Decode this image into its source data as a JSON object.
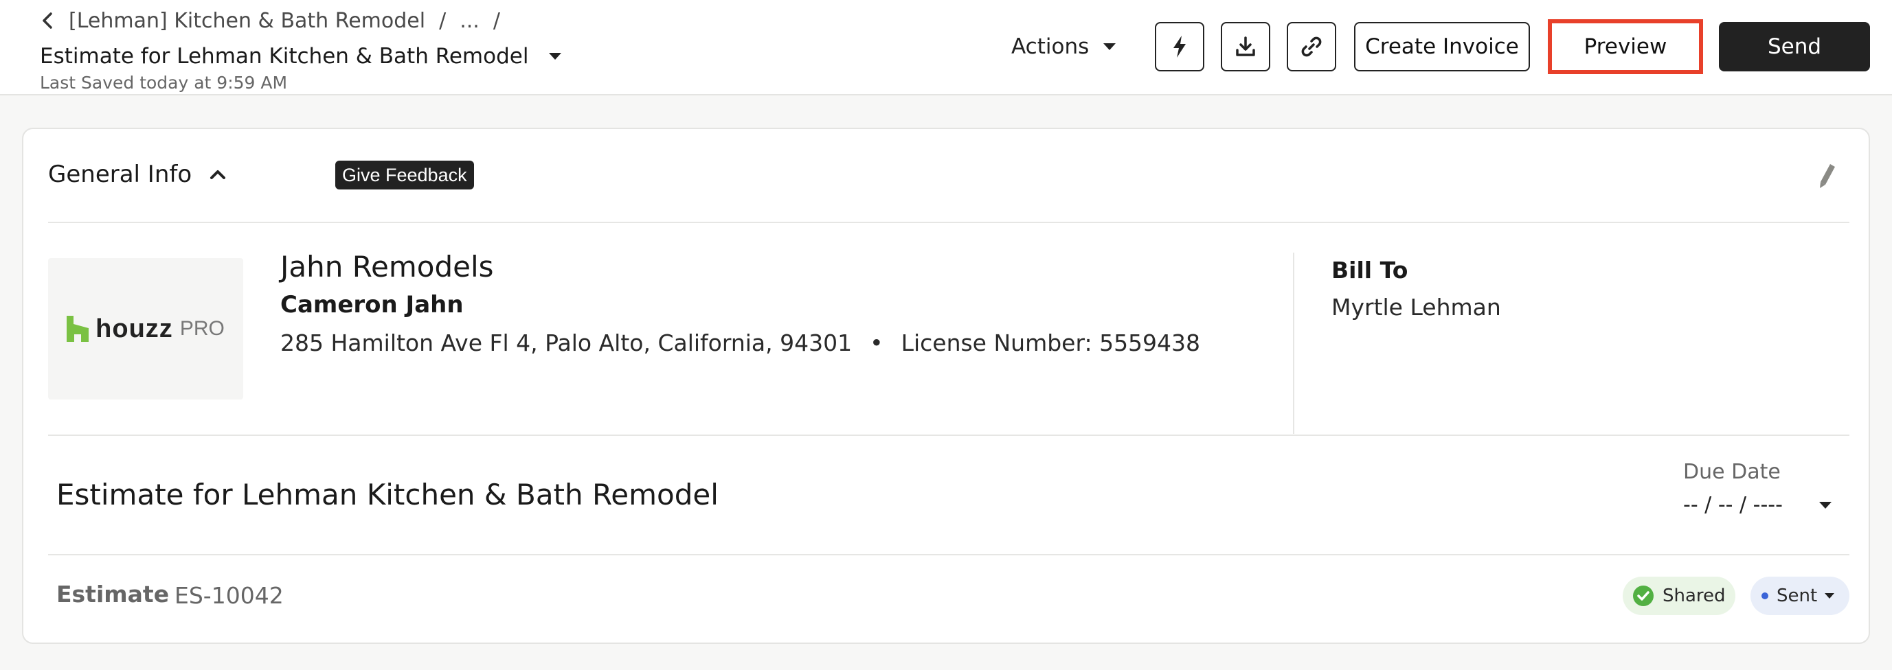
{
  "header": {
    "breadcrumb": {
      "project": "[Lehman] Kitchen & Bath Remodel",
      "separator": "/",
      "ellipsis": "...",
      "trailing_separator": "/"
    },
    "document_title": "Estimate for Lehman Kitchen & Bath Remodel",
    "last_saved": "Last Saved today at 9:59 AM",
    "actions_label": "Actions",
    "icons": {
      "back": "chevron-left-icon",
      "title_dropdown": "caret-down-icon",
      "automation": "lightning-icon",
      "download": "download-icon",
      "link": "link-icon"
    },
    "create_invoice_label": "Create Invoice",
    "preview_label": "Preview",
    "send_label": "Send",
    "highlight_color": "#e8402a"
  },
  "general_info": {
    "title": "General Info",
    "collapse_icon": "chevron-up-icon",
    "feedback_label": "Give Feedback",
    "edit_icon": "pencil-icon"
  },
  "company": {
    "logo_text": "houzz",
    "logo_suffix": "PRO",
    "logo_color": "#7ac143",
    "name": "Jahn Remodels",
    "contact": "Cameron Jahn",
    "address": "285 Hamilton Ave Fl 4, Palo Alto, California, 94301",
    "bullet": "•",
    "license": "License Number: 5559438"
  },
  "bill_to": {
    "label": "Bill To",
    "name": "Myrtle Lehman"
  },
  "estimate": {
    "title": "Estimate for Lehman Kitchen & Bath Remodel",
    "due_date_label": "Due Date",
    "due_date_value": "-- / -- / ----",
    "label": "Estimate",
    "number": "ES-10042",
    "shared_label": "Shared",
    "shared_color": "#52b043",
    "sent_label": "Sent",
    "sent_color": "#3b64d8"
  }
}
